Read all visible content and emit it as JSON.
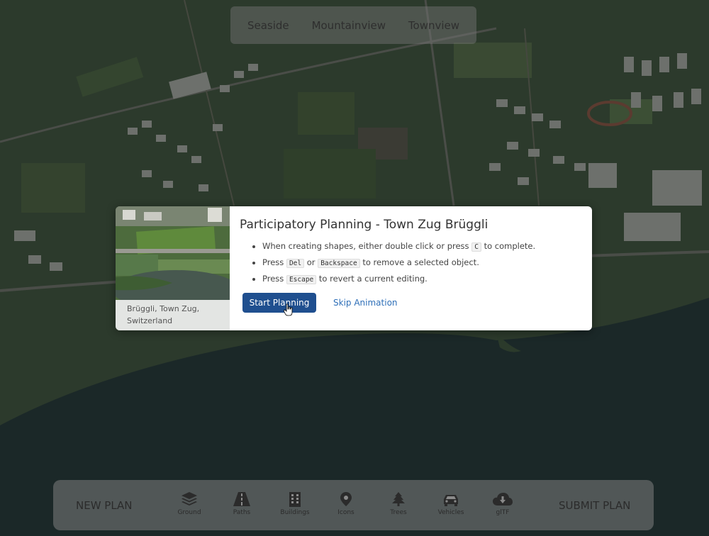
{
  "views": [
    "Seaside",
    "Mountainview",
    "Townview"
  ],
  "modal": {
    "caption": "Brüggli, Town Zug, Switzerland",
    "title": "Participatory Planning - Town Zug Brüggli",
    "tips": {
      "t1_a": "When creating shapes, either double click or press",
      "t1_key": "C",
      "t1_b": "to complete.",
      "t2_a": "Press",
      "t2_key1": "Del",
      "t2_or": "or",
      "t2_key2": "Backspace",
      "t2_b": "to remove a selected object.",
      "t3_a": "Press",
      "t3_key": "Escape",
      "t3_b": "to revert a current editing."
    },
    "start_label": "Start Planning",
    "skip_label": "Skip Animation"
  },
  "toolbar": {
    "new_plan": "NEW PLAN",
    "submit_plan": "SUBMIT PLAN",
    "tools": [
      {
        "label": "Ground",
        "icon": "layers-icon"
      },
      {
        "label": "Paths",
        "icon": "road-icon"
      },
      {
        "label": "Buildings",
        "icon": "building-icon"
      },
      {
        "label": "Icons",
        "icon": "map-pin-icon"
      },
      {
        "label": "Trees",
        "icon": "tree-icon"
      },
      {
        "label": "Vehicles",
        "icon": "car-icon"
      },
      {
        "label": "glTF",
        "icon": "cloud-download-icon"
      }
    ]
  },
  "colors": {
    "primary_button": "#1f4f8f",
    "link": "#2e6fb8",
    "lake": "#1b2a2a",
    "land": "#2b3a2b"
  }
}
